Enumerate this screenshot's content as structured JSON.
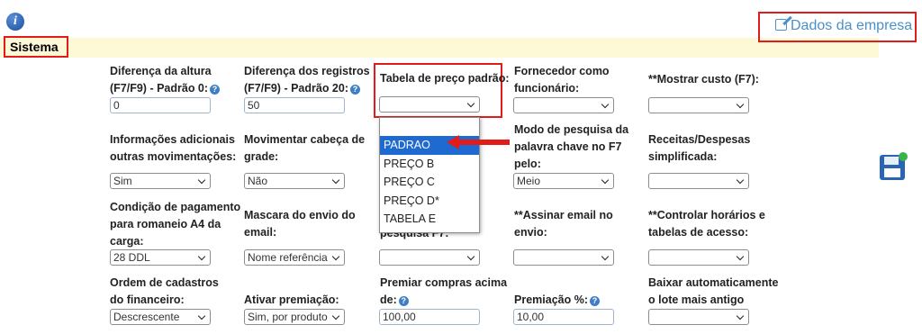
{
  "header": {
    "info_icon": "i",
    "dados_link": "Dados da empresa",
    "section_title": "Sistema"
  },
  "fields": {
    "diferenca_altura": {
      "label_1": "Diferença da altura",
      "label_2": "(F7/F9) - Padrão 0:",
      "value": "0"
    },
    "diferenca_registros": {
      "label_1": "Diferença dos registros",
      "label_2": "(F7/F9) - Padrão 20:",
      "value": "50"
    },
    "tabela_preco": {
      "label": "Tabela de preço padrão:",
      "value": ""
    },
    "fornecedor_func": {
      "label_1": "Fornecedor como",
      "label_2": "funcionário:",
      "value": ""
    },
    "mostrar_custo": {
      "label": "**Mostrar custo (F7):",
      "value": ""
    },
    "info_adicionais": {
      "label_1": "Informações adicionais",
      "label_2": "outras movimentações:",
      "value": "Sim"
    },
    "movimentar_cabeca": {
      "label_1": "Movimentar cabeça de",
      "label_2": "grade:",
      "value": "Não"
    },
    "modo_pesquisa": {
      "label_1": "Modo de pesquisa da",
      "label_2": "palavra chave no F7",
      "label_3": "pelo:",
      "value": "Meio"
    },
    "receitas_despesas": {
      "label_1": "Receitas/Despesas",
      "label_2": "simplificada:",
      "value": ""
    },
    "condicao_pagamento": {
      "label_1": "Condição de pagamento",
      "label_2": "para romaneio A4 da",
      "label_3": "carga:",
      "value": "28 DDL"
    },
    "mascara_envio": {
      "label_1": "Mascara do envio do",
      "label_2": "email:",
      "value": "Nome referência"
    },
    "pesquisa_f7": {
      "label": "pesquisa F7:",
      "value": ""
    },
    "assinar_email": {
      "label_1": "**Assinar email no",
      "label_2": "envio:",
      "value": ""
    },
    "controlar_horarios": {
      "label_1": "**Controlar horários e",
      "label_2": "tabelas de acesso:",
      "value": ""
    },
    "ordem_cadastros": {
      "label_1": "Ordem de cadastros",
      "label_2": "do financeiro:",
      "value": "Descrescente"
    },
    "ativar_premiacao": {
      "label": "Ativar premiação:",
      "value": "Sim, por produto"
    },
    "premiar_compras": {
      "label_1": "Premiar compras acima",
      "label_2": "de:",
      "value": "100,00"
    },
    "premiacao_pct": {
      "label": "Premiação %:",
      "value": "10,00"
    },
    "baixar_lote": {
      "label_1": "Baixar automaticamente",
      "label_2": "o lote mais antigo",
      "value": ""
    }
  },
  "dropdown_options": [
    "",
    "PADRAO",
    "PREÇO B",
    "PREÇO C",
    "PREÇO D*",
    "TABELA E"
  ],
  "help_glyph": "?"
}
